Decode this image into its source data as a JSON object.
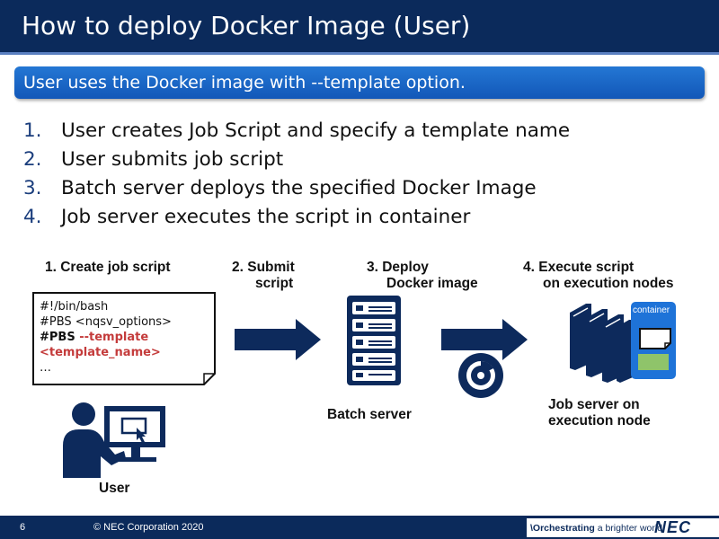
{
  "title": "How to deploy Docker Image (User)",
  "subtitle": "User uses the Docker image with --template option.",
  "steps": [
    {
      "num": "1.",
      "text": "User creates Job Script and specify a template name"
    },
    {
      "num": "2.",
      "text": "User submits job script"
    },
    {
      "num": "3.",
      "text": "Batch server deploys the specified Docker Image"
    },
    {
      "num": "4.",
      "text": "Job server executes the script in container"
    }
  ],
  "diagram": {
    "label_create": "1. Create job script",
    "label_submit_1": "2. Submit",
    "label_submit_2": "script",
    "label_deploy_1": "3. Deploy",
    "label_deploy_2": "Docker image",
    "label_execute_1": "4. Execute script",
    "label_execute_2": "on execution nodes",
    "script_lines": {
      "l1": "#!/bin/bash",
      "l2": "#PBS <nqsv_options>",
      "l3_prefix": "#PBS",
      "l3_option": " --template",
      "l4": "<template_name>",
      "l5": "…"
    },
    "container_label": "container",
    "user_label": "User",
    "batch_label": "Batch server",
    "job_label_1": "Job server on",
    "job_label_2": "execution node"
  },
  "footer": {
    "page": "6",
    "copyright": "© NEC Corporation 2020",
    "tagline_bold": "\\Orchestrating",
    "tagline_rest": " a brighter world",
    "logo": "NEC"
  },
  "colors": {
    "title_bar": "#0b2a5b",
    "subtitle_bar": "#1f6fd1",
    "arrow": "#0d2a5c",
    "code_highlight": "#c43b3b"
  },
  "icons": {
    "user": "person-at-computer-icon",
    "batch": "server-rack-icon",
    "image": "disc-icon",
    "jobserver": "server-cluster-icon",
    "container_doc": "document-icon"
  }
}
